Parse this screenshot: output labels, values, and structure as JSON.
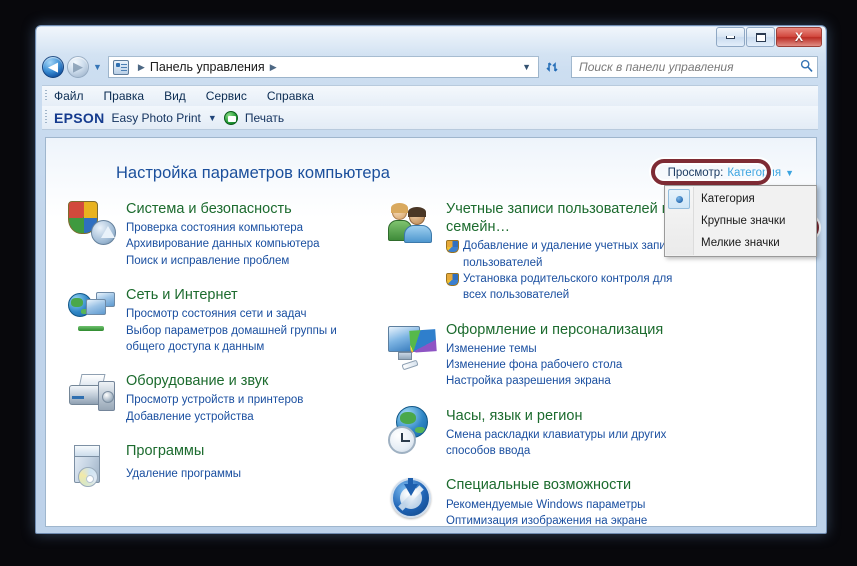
{
  "window": {
    "controls": {
      "minimize_label": "–",
      "maximize_label": "□",
      "close_label": "X"
    }
  },
  "addressbar": {
    "back_glyph": "◀",
    "forward_glyph": "▶",
    "recent_caret": "▼",
    "icon_name": "control-panel-icon",
    "crumb_sep_1": "▶",
    "breadcrumb": "Панель управления",
    "crumb_sep_2": "▶",
    "dropdown_caret": "▼",
    "refresh_glyph": "↻"
  },
  "search": {
    "placeholder": "Поиск в панели управления",
    "value": "",
    "icon": "🔍"
  },
  "menubar": {
    "items": [
      {
        "label": "Файл"
      },
      {
        "label": "Правка"
      },
      {
        "label": "Вид"
      },
      {
        "label": "Сервис"
      },
      {
        "label": "Справка"
      }
    ]
  },
  "toolbar": {
    "epson_logo": "EPSON",
    "product": "Easy Photo Print",
    "caret": "▼",
    "print_label": "Печать"
  },
  "header": {
    "page_title": "Настройка параметров компьютера",
    "view_label": "Просмотр:",
    "view_value": "Категория",
    "view_caret": "▼"
  },
  "view_menu": {
    "items": [
      {
        "label": "Категория",
        "selected": true
      },
      {
        "label": "Крупные значки",
        "selected": false
      },
      {
        "label": "Мелкие значки",
        "selected": false
      }
    ]
  },
  "categories": {
    "left": [
      {
        "title": "Система и безопасность",
        "icon": "security-icon",
        "links": [
          {
            "text": "Проверка состояния компьютера",
            "shield": false
          },
          {
            "text": "Архивирование данных компьютера",
            "shield": false
          },
          {
            "text": "Поиск и исправление проблем",
            "shield": false
          }
        ]
      },
      {
        "title": "Сеть и Интернет",
        "icon": "network-icon",
        "links": [
          {
            "text": "Просмотр состояния сети и задач",
            "shield": false
          },
          {
            "text": "Выбор параметров домашней группы и общего доступа к данным",
            "shield": false
          }
        ]
      },
      {
        "title": "Оборудование и звук",
        "icon": "hardware-icon",
        "links": [
          {
            "text": "Просмотр устройств и принтеров",
            "shield": false
          },
          {
            "text": "Добавление устройства",
            "shield": false
          }
        ]
      },
      {
        "title": "Программы",
        "icon": "programs-icon",
        "links": [
          {
            "text": "Удаление программы",
            "shield": false
          }
        ]
      }
    ],
    "right": [
      {
        "title": "Учетные записи пользователей и семейн…",
        "icon": "user-accounts-icon",
        "links": [
          {
            "text": "Добавление и удаление учетных записей пользователей",
            "shield": true
          },
          {
            "text": "Установка родительского контроля для всех пользователей",
            "shield": true
          }
        ]
      },
      {
        "title": "Оформление и персонализация",
        "icon": "appearance-icon",
        "links": [
          {
            "text": "Изменение темы",
            "shield": false
          },
          {
            "text": "Изменение фона рабочего стола",
            "shield": false
          },
          {
            "text": "Настройка разрешения экрана",
            "shield": false
          }
        ]
      },
      {
        "title": "Часы, язык и регион",
        "icon": "clock-language-region-icon",
        "links": [
          {
            "text": "Смена раскладки клавиатуры или других способов ввода",
            "shield": false
          }
        ]
      },
      {
        "title": "Специальные возможности",
        "icon": "ease-of-access-icon",
        "links": [
          {
            "text": "Рекомендуемые Windows параметры",
            "shield": false
          },
          {
            "text": "Оптимизация изображения на экране",
            "shield": false
          }
        ]
      }
    ]
  },
  "annotations": {
    "view_button_highlight": "Категория",
    "menu_item_highlight": "Крупные значки",
    "color": "#7e2b34"
  },
  "colors": {
    "category_title": "#1c6b2e",
    "link": "#1a4fa0",
    "page_title": "#1b4f9c",
    "view_value": "#3ba4e0",
    "accent_close": "#d2483e"
  }
}
